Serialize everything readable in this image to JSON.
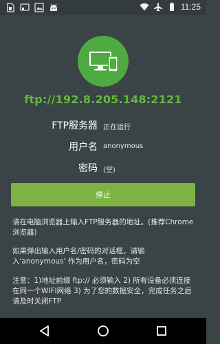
{
  "status_bar": {
    "time": "11:25",
    "left_icons": [
      "sim-icon",
      "cast-icon",
      "image-icon",
      "android-icon"
    ],
    "right_icons": [
      "wifi-icon",
      "airplane-icon",
      "battery-icon"
    ]
  },
  "server": {
    "address": "ftp://192.8.205.148:2121",
    "rows": [
      {
        "label": "FTP服务器",
        "value": "正在运行"
      },
      {
        "label": "用户名",
        "value": "anonymous"
      },
      {
        "label": "密码",
        "value": "(空)"
      }
    ]
  },
  "actions": {
    "stop_label": "停止"
  },
  "notes": {
    "browser": "请在电脑浏览器上输入FTP服务器的地址。(推荐Chrome浏览器)",
    "login": "如果弹出输入用户名/密码的对话框，请输入'anonymous' 作为用户名，密码为空",
    "warning": "注意：1)地址前缀 ftp:// 必须输入 2) 所有设备必须连接在同一个WIFI网络 3) 为了您的数据安全，完成任务之后请及时关闭FTP"
  },
  "colors": {
    "background": "#3a4345",
    "accent_green": "#4faa42",
    "address_green": "#63b83f",
    "button_green": "#7cb342"
  },
  "nav_bar": {
    "buttons": [
      "back-icon",
      "home-icon",
      "recents-icon"
    ]
  }
}
